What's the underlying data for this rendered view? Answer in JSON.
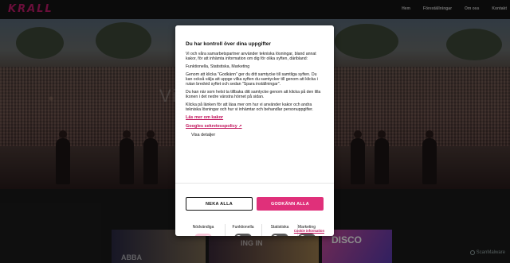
{
  "header": {
    "logo": "KRALL",
    "nav": [
      "Hem",
      "Föreställningar",
      "Om oss",
      "Kontakt"
    ]
  },
  "hero": {
    "title_fragment": "Vi"
  },
  "posters": {
    "p1": "ABBA",
    "p2": "ING IN",
    "p3": "DISCO"
  },
  "scanmalware": "ScanMalware",
  "consent": {
    "title": "Du har kontroll över dina uppgifter",
    "paragraphs": [
      "Vi och våra samarbetspartner använder tekniska lösningar, bland annat kakor, för att inhämta information om dig för olika syften, däribland:",
      "Funktionella, Statistiska, Marketing",
      "Genom att klicka \"Godkänn\" ger du ditt samtycke till samtliga syften. Du kan också välja att uppge vilka syften du samtycker till genom att klicka i rutan bredvid syftet och sedan \"Spara inställningar\".",
      "Du kan när som helst ta tillbaka ditt samtycke genom att klicka på den lilla ikonen i det nedre vänstra hörnet på sidan.",
      "Klicka på länken för att läsa mer om hur vi använder kakor och andra tekniska lösningar och hur vi inhämtar och behandlar personuppgifter."
    ],
    "link_cookies": "Läs mer om kakor",
    "link_google": "Googles sekretesspolicy",
    "show_details": "Visa detaljer",
    "deny_label": "NEKA ALLA",
    "accept_label": "GODKÄNN ALLA",
    "categories": [
      {
        "label": "Nödvändiga",
        "on": true
      },
      {
        "label": "Funktionella",
        "on": false
      },
      {
        "label": "Statistiska",
        "on": false
      },
      {
        "label": "Marketing",
        "on": false
      }
    ],
    "cookie_info": "Cookie information",
    "colors": {
      "accent": "#e0307a",
      "link": "#c0125a",
      "toggle_off": "#5a5a5a",
      "toggle_on": "#f6c6d8"
    }
  }
}
